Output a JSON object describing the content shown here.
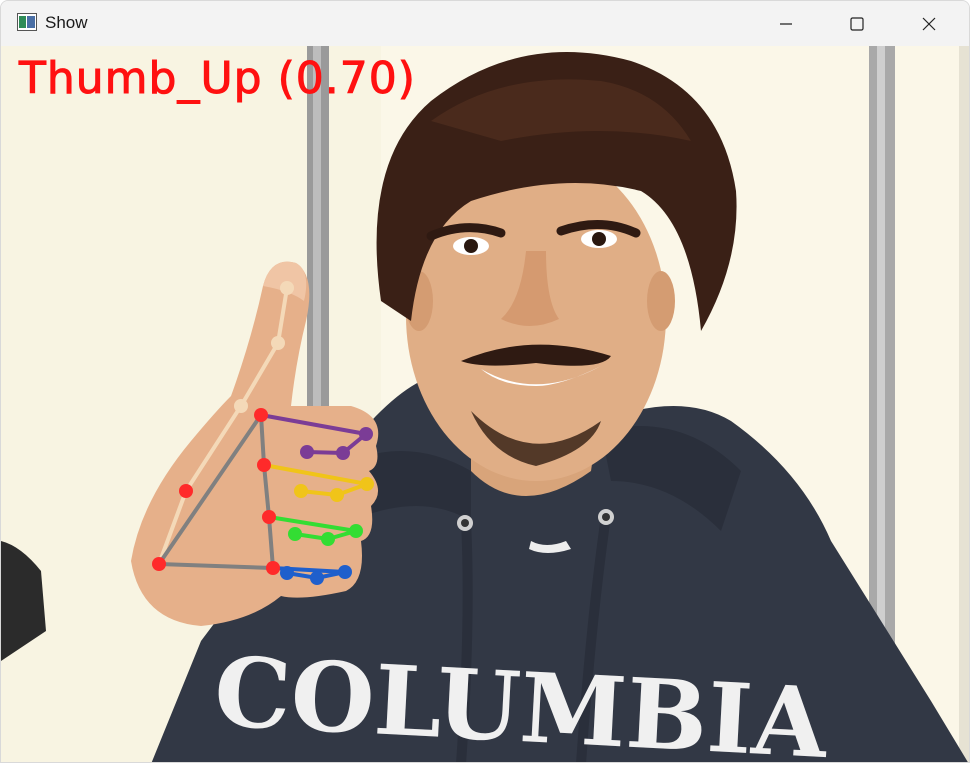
{
  "window": {
    "title": "Show",
    "icon": "app-window-icon",
    "controls": [
      "minimize-icon",
      "maximize-icon",
      "close-icon"
    ]
  },
  "overlay": {
    "gesture_label": "Thumb_Up (0.70)",
    "label_color": "#ff1111"
  },
  "landmarks": {
    "thumb_color": "#f4d9b8",
    "index_color": "#7b3c96",
    "middle_color": "#f0c419",
    "ring_color": "#33dd33",
    "pinky_color": "#1f5fcc",
    "palm_color": "#ff2a2a",
    "connection_color": "#808080"
  },
  "scene": {
    "shirt_text": "COLUMBIA"
  }
}
